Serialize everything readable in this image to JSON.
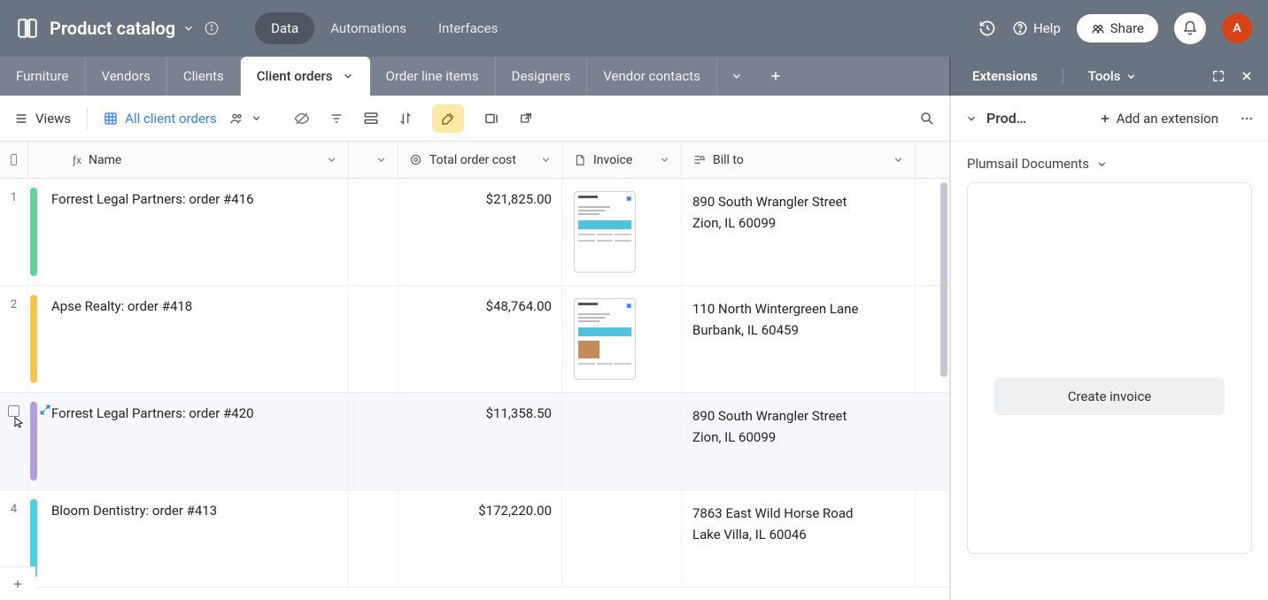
{
  "header": {
    "base_name": "Product catalog",
    "tabs": [
      "Data",
      "Automations",
      "Interfaces"
    ],
    "active_tab": 0,
    "help": "Help",
    "share": "Share",
    "avatar_letter": "A"
  },
  "tables": {
    "items": [
      "Furniture",
      "Vendors",
      "Clients",
      "Client orders",
      "Order line items",
      "Designers",
      "Vendor contacts"
    ],
    "active": 3
  },
  "ext_header": {
    "extensions": "Extensions",
    "tools": "Tools"
  },
  "toolbar": {
    "views": "Views",
    "view_name": "All client orders"
  },
  "columns": {
    "name": "Name",
    "cost": "Total order cost",
    "invoice": "Invoice",
    "billto": "Bill to"
  },
  "rows": [
    {
      "num": "1",
      "color": "bar-green",
      "name": "Forrest Legal Partners: order #416",
      "cost": "$21,825.00",
      "has_invoice": true,
      "invoice_variant": "a",
      "bill1": "890 South Wrangler Street",
      "bill2": "Zion, IL 60099"
    },
    {
      "num": "2",
      "color": "bar-yellow",
      "name": "Apse Realty: order #418",
      "cost": "$48,764.00",
      "has_invoice": true,
      "invoice_variant": "b",
      "bill1": "110 North Wintergreen Lane",
      "bill2": "Burbank, IL 60459"
    },
    {
      "num": "",
      "color": "bar-purple",
      "name": "Forrest Legal Partners: order #420",
      "cost": "$11,358.50",
      "has_invoice": false,
      "hovered": true,
      "bill1": "890 South Wrangler Street",
      "bill2": "Zion, IL 60099"
    },
    {
      "num": "4",
      "color": "bar-teal",
      "name": "Bloom Dentistry: order #413",
      "cost": "$172,220.00",
      "has_invoice": false,
      "bill1": "7863 East Wild Horse Road",
      "bill2": "Lake Villa, IL 60046"
    }
  ],
  "panel": {
    "title": "Prod…",
    "add_ext": "Add an extension",
    "ext_name": "Plumsail Documents",
    "create_btn": "Create invoice"
  }
}
